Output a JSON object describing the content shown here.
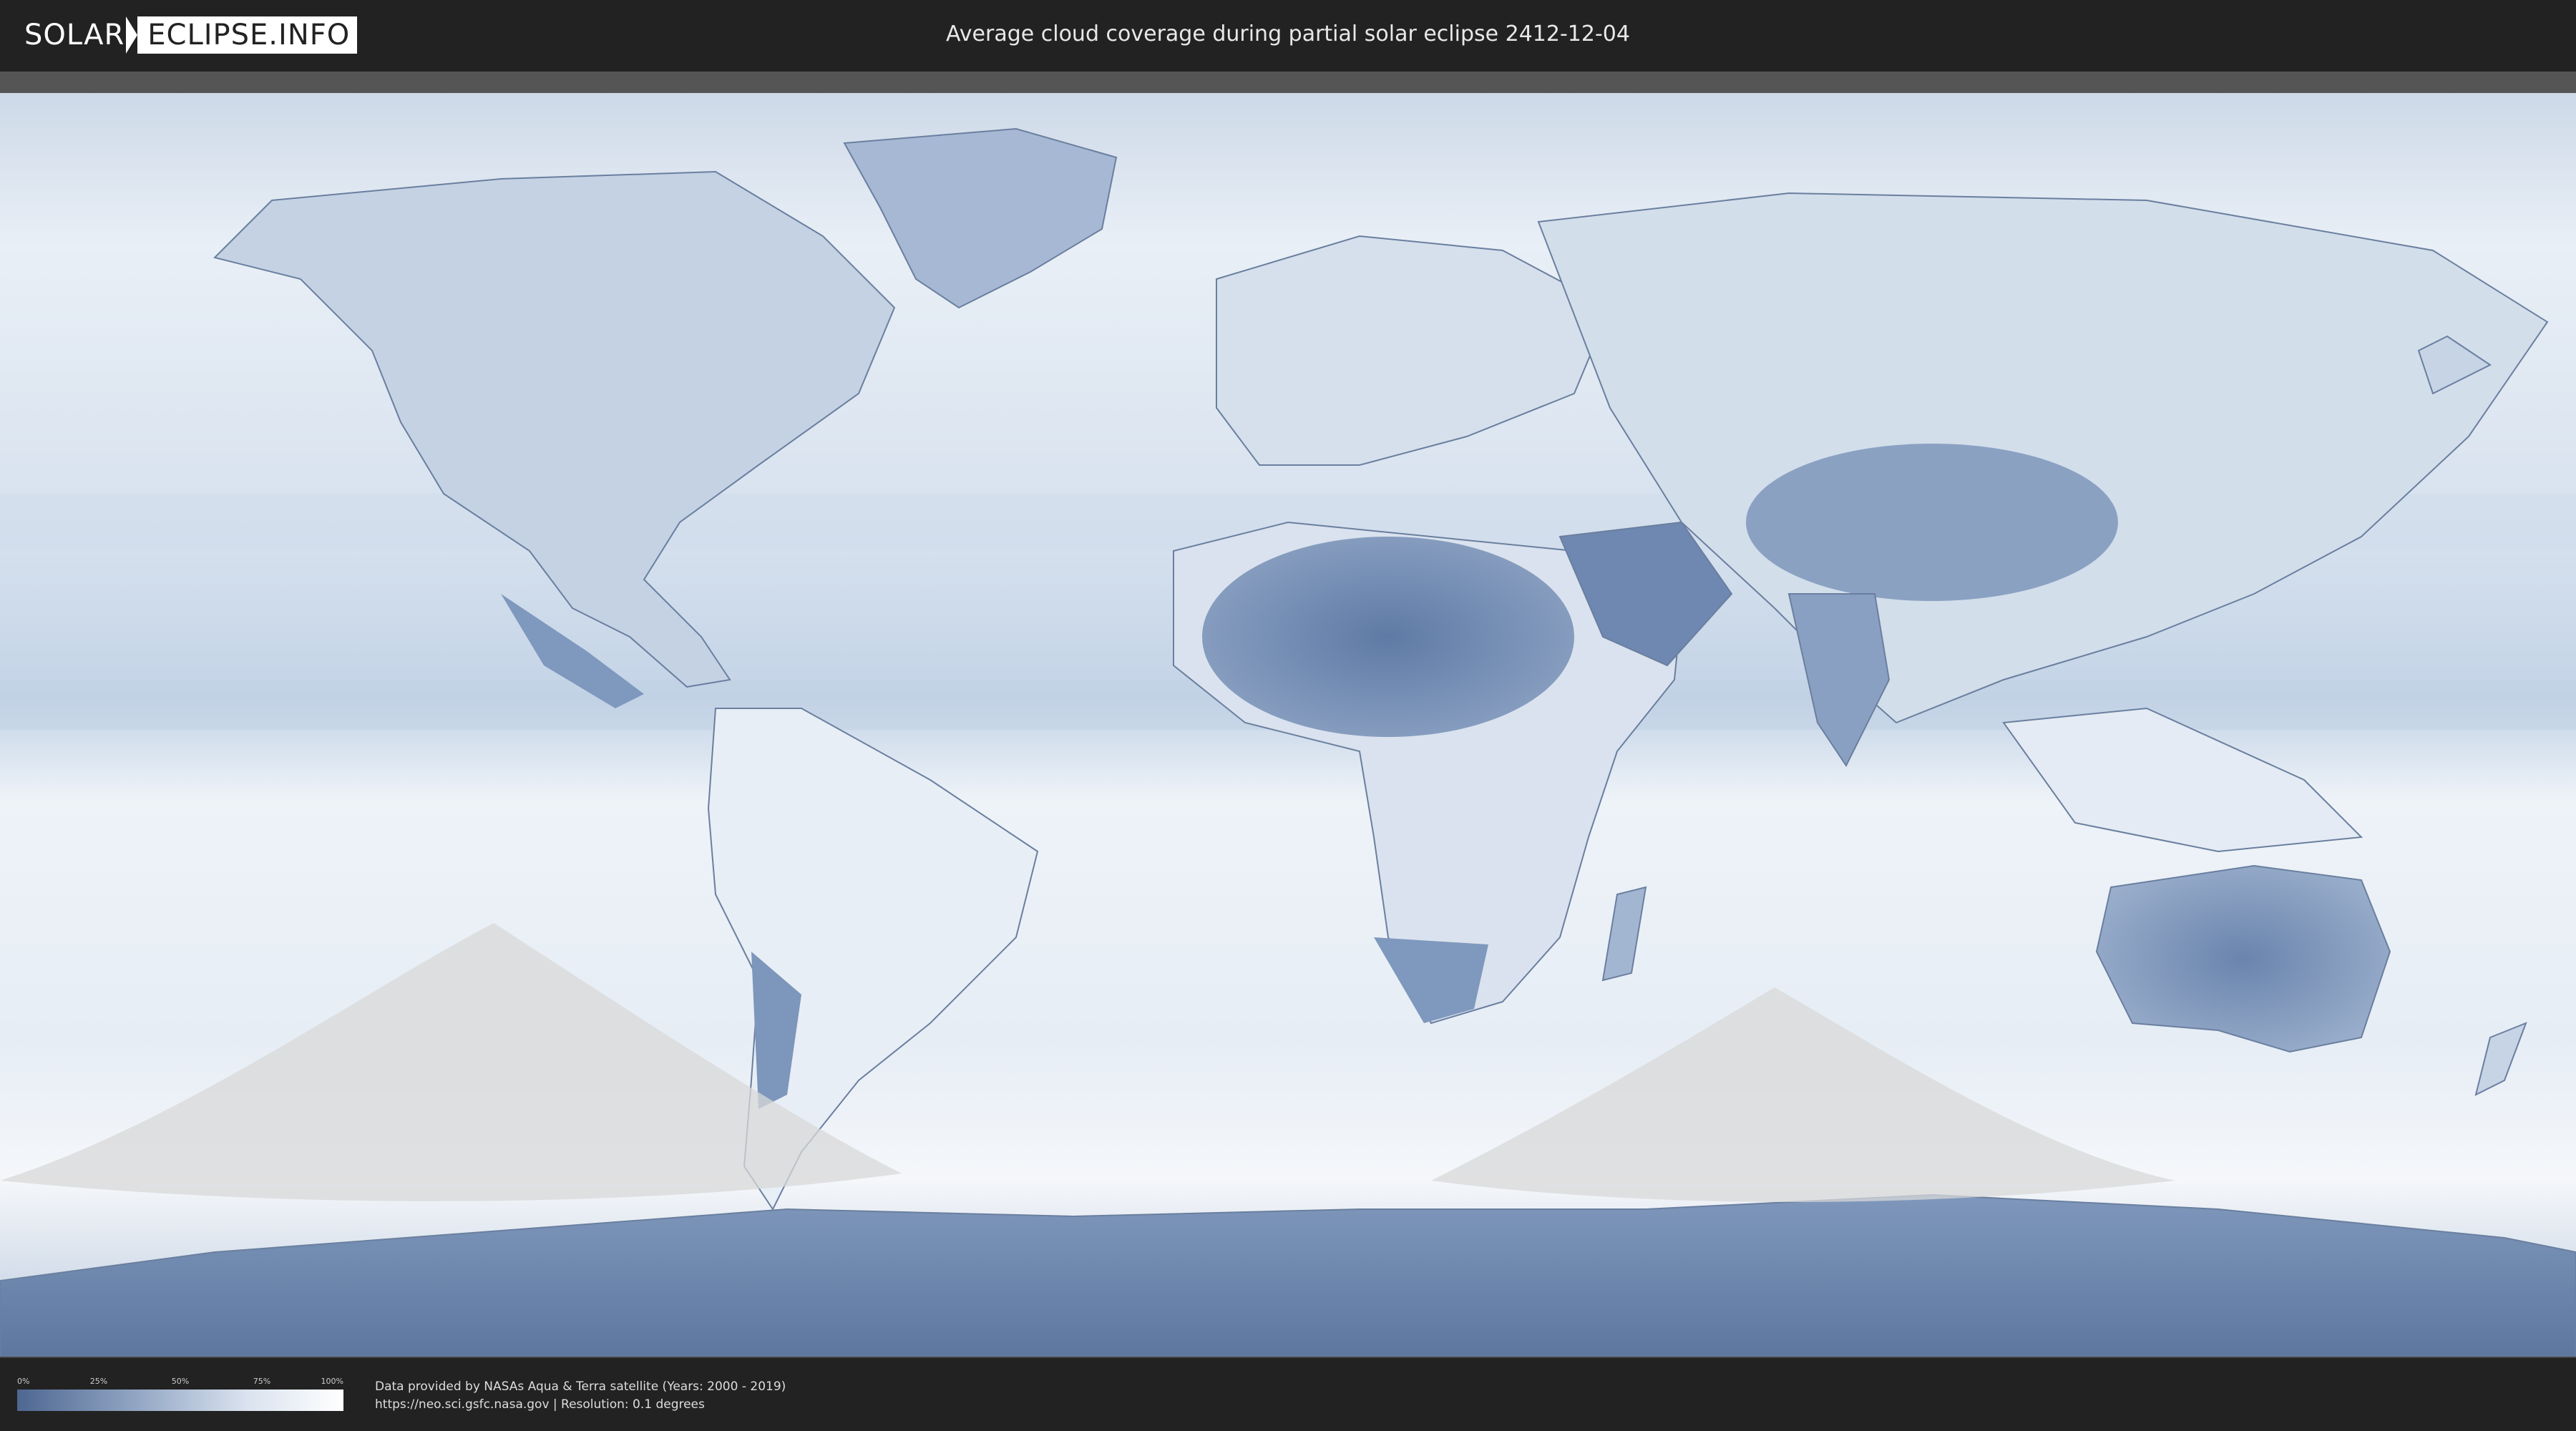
{
  "header": {
    "logo_left": "SOLAR",
    "logo_right": "ECLIPSE.INFO",
    "title": "Average cloud coverage during partial solar eclipse 2412-12-04"
  },
  "legend": {
    "ticks": [
      "0%",
      "25%",
      "50%",
      "75%",
      "100%"
    ],
    "gradient_colors": [
      "#4e6791",
      "#8fa3c2",
      "#d9e2ee",
      "#ffffff"
    ]
  },
  "credits": {
    "line1": "Data provided by NASAs Aqua & Terra satellite (Years: 2000 - 2019)",
    "line2": "https://neo.sci.gsfc.nasa.gov | Resolution: 0.1 degrees"
  },
  "map": {
    "projection": "equirectangular world map",
    "ocean_color": "#e3ebf4",
    "land_clear_color": "#6f87ae",
    "land_cloudy_color": "#f2f5f9",
    "eclipse_shadow_color": "#d8d8d8"
  }
}
